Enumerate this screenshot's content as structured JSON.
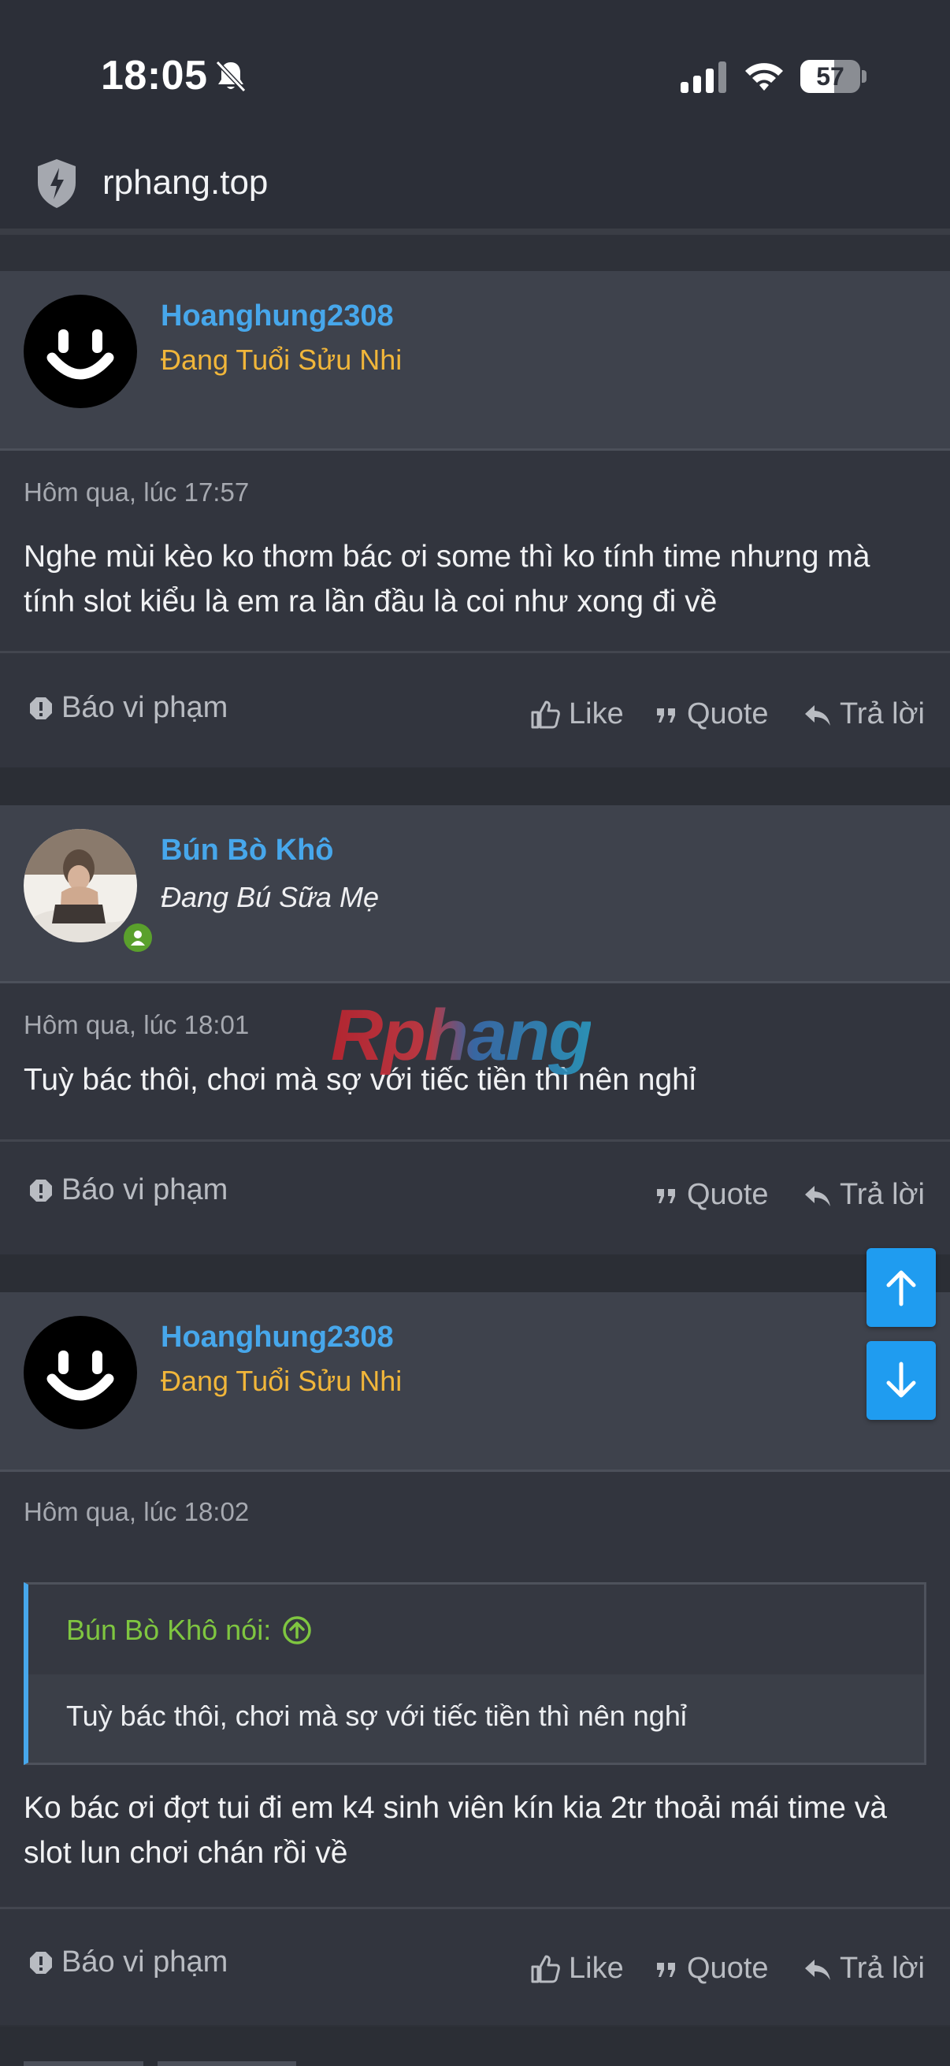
{
  "status_bar": {
    "time": "18:05",
    "battery": "57",
    "battery_level": 0.57
  },
  "browser": {
    "url": "rphang.top"
  },
  "watermark": "Rphang",
  "posts": [
    {
      "username": "Hoanghung2308",
      "user_title": "Đang Tuổi Sửu Nhi",
      "date": "Hôm qua, lúc 17:57",
      "message": "Nghe mùi kèo ko thơm bác ơi some thì ko tính time nhưng mà tính slot kiểu là em ra lần đầu là coi như xong đi về",
      "report": "Báo vi phạm",
      "like": "Like",
      "quote": "Quote",
      "reply": "Trả lời"
    },
    {
      "username": "Bún Bò Khô",
      "user_title": "Đang Bú Sữa Mẹ",
      "date": "Hôm qua, lúc 18:01",
      "message": "Tuỳ bác thôi, chơi mà sợ với tiếc tiền thì nên nghỉ",
      "report": "Báo vi phạm",
      "quote": "Quote",
      "reply": "Trả lời"
    },
    {
      "username": "Hoanghung2308",
      "user_title": "Đang Tuổi Sửu Nhi",
      "date": "Hôm qua, lúc 18:02",
      "quote_author": "Bún Bò Khô nói:",
      "quote_text": "Tuỳ bác thôi, chơi mà sợ với tiếc tiền thì nên nghỉ",
      "message": "Ko bác ơi đợt tui đi em k4 sinh viên kín kia 2tr thoải mái time và slot lun chơi chán rồi về",
      "report": "Báo vi phạm",
      "like": "Like",
      "quote": "Quote",
      "reply": "Trả lời"
    }
  ],
  "colors": {
    "link": "#47a7eb",
    "gold_title": "#f1b63a",
    "quote_author": "#7fc640",
    "scroll_button": "#1f9cf0"
  },
  "icons": [
    "bell-slash-icon",
    "signal-icon",
    "wifi-icon",
    "battery-icon",
    "shield-icon",
    "smiley-avatar-icon",
    "exclamation-icon",
    "thumbs-up-icon",
    "quote-icon",
    "reply-icon",
    "arrow-up-icon",
    "arrow-down-icon",
    "online-user-icon",
    "circle-arrow-up-icon"
  ]
}
